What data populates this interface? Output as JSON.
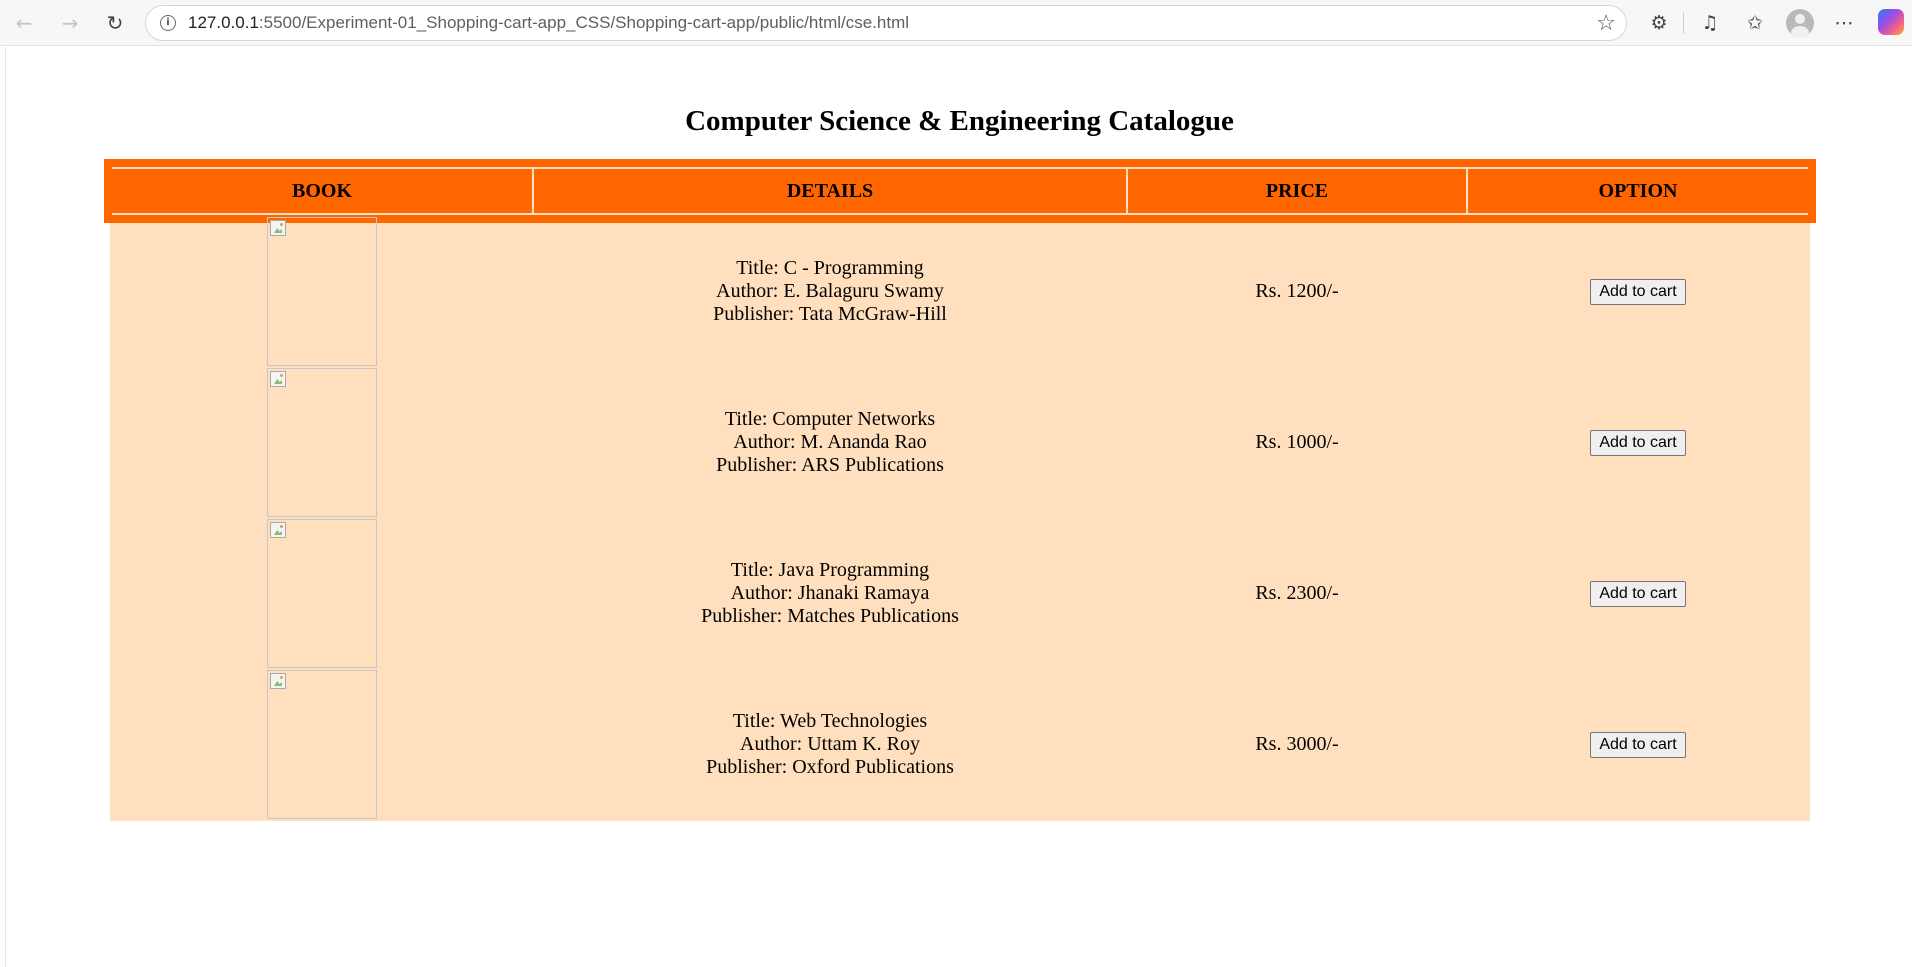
{
  "browser": {
    "url_host": "127.0.0.1",
    "url_rest": ":5500/Experiment-01_Shopping-cart-app_CSS/Shopping-cart-app/public/html/cse.html"
  },
  "page": {
    "title": "Computer Science & Engineering Catalogue"
  },
  "table": {
    "headers": [
      "BOOK",
      "DETAILS",
      "PRICE",
      "OPTION"
    ],
    "rows": [
      {
        "title": "Title: C - Programming",
        "author": "Author: E. Balaguru Swamy",
        "publisher": "Publisher: Tata McGraw-Hill",
        "price": "Rs. 1200/-",
        "button": "Add to cart"
      },
      {
        "title": "Title: Computer Networks",
        "author": "Author: M. Ananda Rao",
        "publisher": "Publisher: ARS Publications",
        "price": "Rs. 1000/-",
        "button": "Add to cart"
      },
      {
        "title": "Title: Java Programming",
        "author": "Author: Jhanaki Ramaya",
        "publisher": "Publisher: Matches Publications",
        "price": "Rs. 2300/-",
        "button": "Add to cart"
      },
      {
        "title": "Title: Web Technologies",
        "author": "Author: Uttam K. Roy",
        "publisher": "Publisher: Oxford Publications",
        "price": "Rs. 3000/-",
        "button": "Add to cart"
      }
    ]
  },
  "colors": {
    "header_bg": "#ff6600",
    "table_bg": "#ffdfbd"
  },
  "icons": [
    "back-icon",
    "forward-icon",
    "reload-icon",
    "site-info-icon",
    "favorite-star-icon",
    "extensions-icon",
    "media-icon",
    "favorites-icon",
    "profile-icon",
    "more-icon",
    "copilot-icon",
    "broken-image-icon"
  ]
}
